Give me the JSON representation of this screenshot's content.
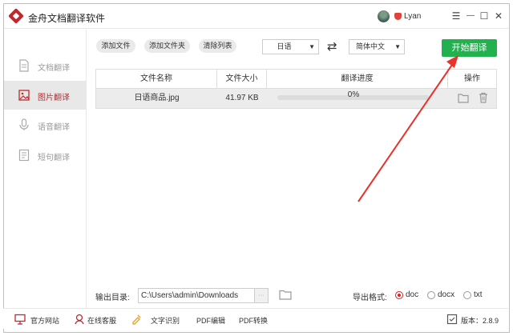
{
  "app": {
    "title": "金舟文档翻译软件",
    "username": "Lyan"
  },
  "window_controls": {
    "menu": "☰",
    "minimize": "—",
    "maximize": "☐",
    "close": "✕"
  },
  "sidebar": {
    "items": [
      {
        "label": "文档翻译",
        "icon": "document-icon",
        "active": false
      },
      {
        "label": "图片翻译",
        "icon": "image-icon",
        "active": true
      },
      {
        "label": "语音翻译",
        "icon": "microphone-icon",
        "active": false
      },
      {
        "label": "短句翻译",
        "icon": "text-icon",
        "active": false
      }
    ]
  },
  "toolbar": {
    "add_file": "添加文件",
    "add_folder": "添加文件夹",
    "clear_list": "清除列表",
    "source_lang": "日语",
    "target_lang": "简体中文",
    "swap_icon": "⇄",
    "start_label": "开始翻译"
  },
  "table": {
    "headers": {
      "name": "文件名称",
      "size": "文件大小",
      "progress": "翻译进度",
      "actions": "操作"
    },
    "rows": [
      {
        "name": "日语商品.jpg",
        "size": "41.97 KB",
        "progress_text": "0%",
        "progress": 0
      }
    ]
  },
  "output": {
    "label": "输出目录:",
    "path": "C:\\Users\\admin\\Downloads",
    "browse": "···",
    "format_label": "导出格式:",
    "formats": [
      {
        "label": "doc",
        "selected": true
      },
      {
        "label": "docx",
        "selected": false
      },
      {
        "label": "txt",
        "selected": false
      }
    ]
  },
  "footer": {
    "website": "官方网站",
    "support": "在线客服",
    "ocr": "文字识别",
    "pdf_edit": "PDF编辑",
    "pdf_convert": "PDF转换",
    "version": "版本：2.8.9"
  },
  "colors": {
    "accent": "#c0282d",
    "start_button": "#21b14e",
    "annotation": "#e8322b"
  }
}
